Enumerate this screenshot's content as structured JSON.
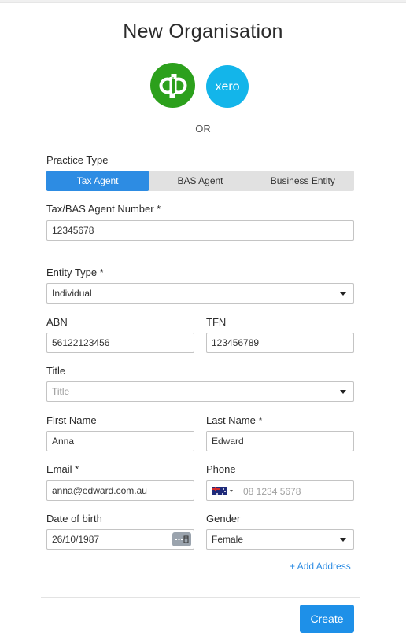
{
  "page": {
    "title": "New Organisation",
    "or_text": "OR"
  },
  "integrations": {
    "quickbooks": {
      "icon": "quickbooks-logo",
      "color": "#2ca01c"
    },
    "xero": {
      "icon": "xero-logo",
      "text": "xero",
      "color": "#13b5ea"
    }
  },
  "practice_type": {
    "label": "Practice Type",
    "options": [
      "Tax Agent",
      "BAS Agent",
      "Business Entity"
    ],
    "selected": "Tax Agent",
    "accent": "#2d8ce3"
  },
  "agent_number": {
    "label": "Tax/BAS Agent Number *",
    "value": "12345678"
  },
  "entity_type": {
    "label": "Entity Type *",
    "value": "Individual"
  },
  "abn": {
    "label": "ABN",
    "value": "56122123456"
  },
  "tfn": {
    "label": "TFN",
    "value": "123456789"
  },
  "title_field": {
    "label": "Title",
    "placeholder": "Title"
  },
  "first_name": {
    "label": "First Name",
    "value": "Anna"
  },
  "last_name": {
    "label": "Last Name *",
    "value": "Edward"
  },
  "email": {
    "label": "Email *",
    "value": "anna@edward.com.au"
  },
  "phone": {
    "label": "Phone",
    "placeholder": "08 1234 5678",
    "country_icon": "australia-flag-icon"
  },
  "dob": {
    "label": "Date of birth",
    "value": "26/10/1987"
  },
  "gender": {
    "label": "Gender",
    "value": "Female"
  },
  "actions": {
    "add_address": "+ Add Address",
    "create": "Create"
  }
}
